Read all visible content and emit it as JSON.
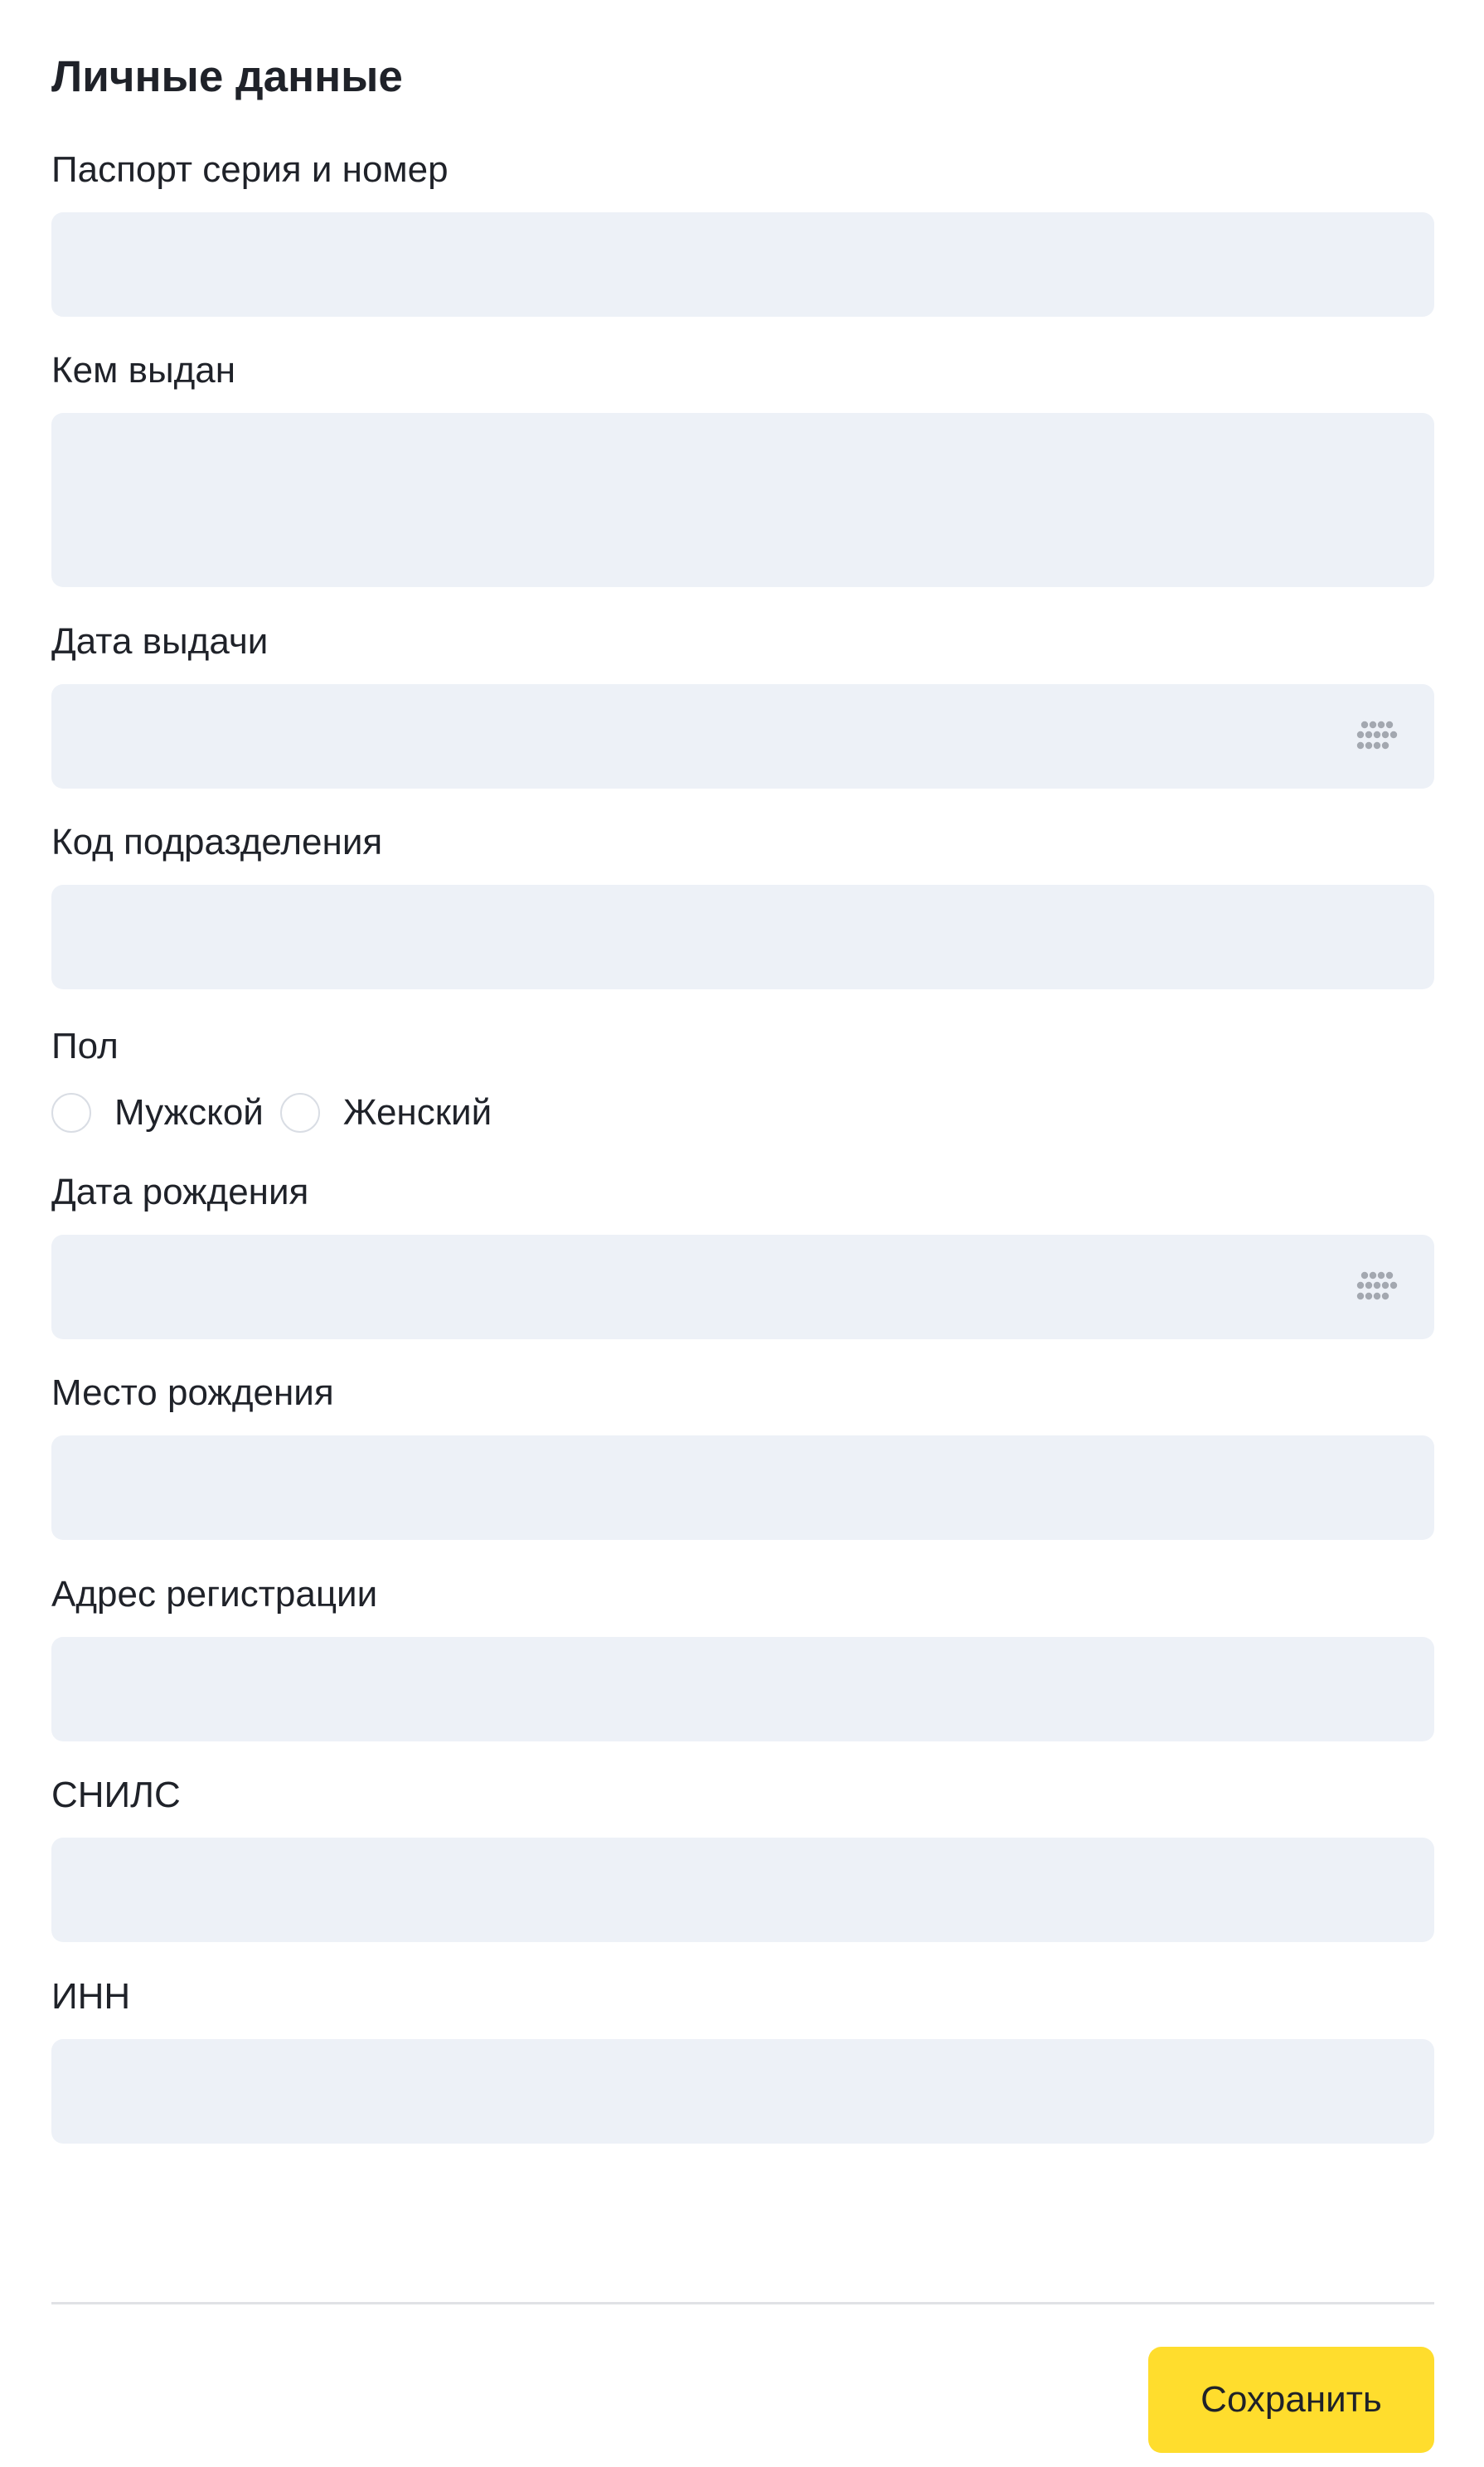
{
  "form": {
    "title": "Личные данные",
    "fields": {
      "passport": {
        "label": "Паспорт серия и номер",
        "value": ""
      },
      "issued_by": {
        "label": "Кем выдан",
        "value": ""
      },
      "issue_date": {
        "label": "Дата выдачи",
        "value": ""
      },
      "division_code": {
        "label": "Код подразделения",
        "value": ""
      },
      "birth_date": {
        "label": "Дата рождения",
        "value": ""
      },
      "birth_place": {
        "label": "Место рождения",
        "value": ""
      },
      "registration_address": {
        "label": "Адрес регистрации",
        "value": ""
      },
      "snils": {
        "label": "СНИЛС",
        "value": ""
      },
      "inn": {
        "label": "ИНН",
        "value": ""
      }
    },
    "gender": {
      "label": "Пол",
      "options": [
        "Мужской",
        "Женский"
      ],
      "selected": null
    }
  },
  "footer": {
    "save_label": "Сохранить"
  },
  "colors": {
    "field_background": "#edf1f7",
    "button_accent": "#ffdd2d",
    "text": "#1f2229",
    "icon": "#a3a8b0",
    "divider": "#e0e2e6"
  },
  "icons": {
    "date_picker": "calendar-dots-icon"
  }
}
